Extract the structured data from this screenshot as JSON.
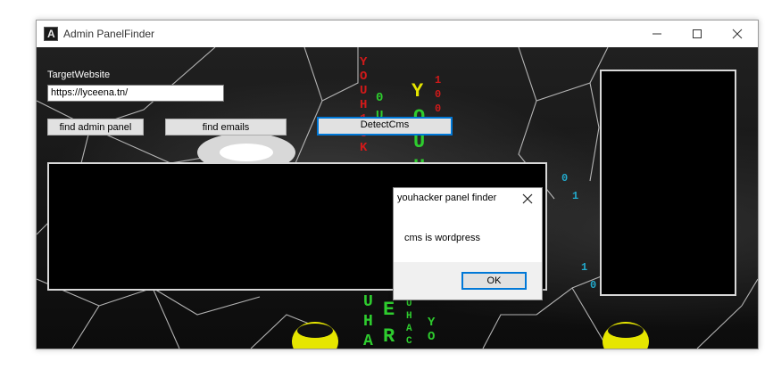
{
  "window": {
    "title": "Admin PanelFinder",
    "icon_letter": "A",
    "controls": [
      "minimize-icon",
      "maximize-icon",
      "close-icon"
    ]
  },
  "form": {
    "target_label": "TargetWebsite",
    "target_value": "https://lyceena.tn/",
    "buttons": {
      "find_admin": "find admin panel",
      "find_emails": "find emails",
      "detect_cms": "DetectCms"
    }
  },
  "background": {
    "matrix_letters": [
      "Y",
      "O",
      "U",
      "H",
      "A",
      "C",
      "K",
      "E",
      "R"
    ]
  },
  "dialog": {
    "title": "youhacker panel finder",
    "message": "cms is wordpress",
    "ok_label": "OK"
  },
  "colors": {
    "accent": "#0078d7",
    "matrix_green": "#2ecc2e",
    "matrix_red": "#d01a1a",
    "mask_yellow": "#e6e600"
  }
}
